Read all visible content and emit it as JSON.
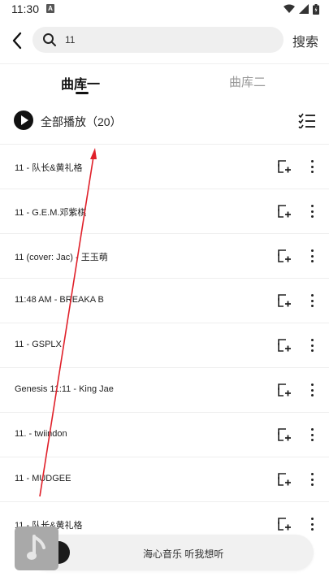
{
  "status_bar": {
    "time": "11:30",
    "notification_icon": "a-icon",
    "right_icons": [
      "wifi-icon",
      "signal-icon",
      "battery-icon"
    ]
  },
  "search": {
    "query": "11",
    "submit_label": "搜索"
  },
  "tabs": [
    {
      "label": "曲库一",
      "active": true
    },
    {
      "label": "曲库二",
      "active": false
    }
  ],
  "play_all": {
    "label": "全部播放",
    "count": "（20）"
  },
  "songs": [
    {
      "title": "11 - 队长&黄礼格"
    },
    {
      "title": "11 - G.E.M.邓紫棋"
    },
    {
      "title": "11 (cover: Jac) - 王玉萌"
    },
    {
      "title": "11:48 AM - BREAKA B"
    },
    {
      "title": "11 - GSPLX"
    },
    {
      "title": "Genesis 11:11 - King Jae"
    },
    {
      "title": "11. - twiindon"
    },
    {
      "title": "11 - MUDGEE"
    },
    {
      "title": "11 - 队长&黄礼格"
    }
  ],
  "mini_player": {
    "text": "海心音乐 听我想听"
  },
  "colors": {
    "accent": "#111111",
    "overlay_arrow": "#e0202a",
    "search_bg": "#efefef"
  }
}
